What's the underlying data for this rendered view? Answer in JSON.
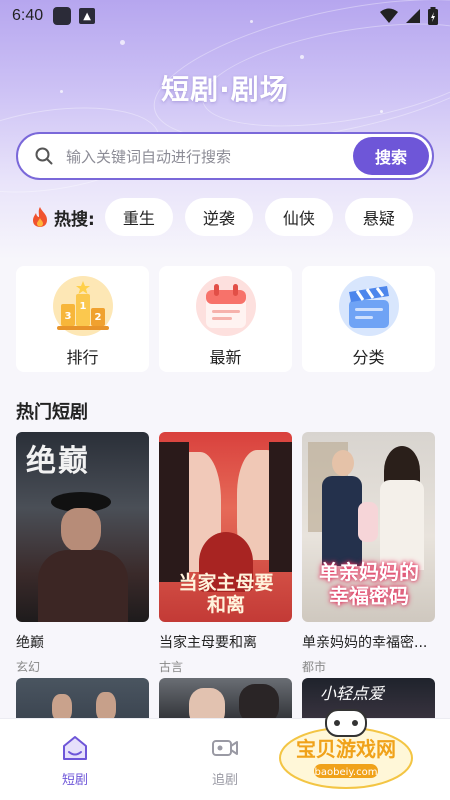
{
  "status_bar": {
    "time": "6:40"
  },
  "header": {
    "title": "短剧·剧场"
  },
  "search": {
    "placeholder": "输入关键词自动进行搜索",
    "button_label": "搜索"
  },
  "hot_search": {
    "label": "热搜:",
    "tags": [
      "重生",
      "逆袭",
      "仙侠",
      "悬疑"
    ]
  },
  "categories": [
    {
      "label": "排行",
      "icon": "podium-icon"
    },
    {
      "label": "最新",
      "icon": "calendar-icon"
    },
    {
      "label": "分类",
      "icon": "clapperboard-icon"
    }
  ],
  "section": {
    "title": "热门短剧"
  },
  "dramas": [
    {
      "title": "绝巅",
      "tag": "玄幻",
      "poster_text": "绝巅"
    },
    {
      "title": "当家主母要和离",
      "tag": "古言",
      "poster_text": "当家主母要和离"
    },
    {
      "title": "单亲妈妈的幸福密...",
      "tag": "都市",
      "poster_text": "单亲妈妈的幸福密码"
    }
  ],
  "second_row": {
    "poster_text": "小轻点爱"
  },
  "tabbar": {
    "items": [
      {
        "label": "短剧",
        "active": true,
        "icon": "home-icon"
      },
      {
        "label": "追剧",
        "active": false,
        "icon": "video-camera-icon"
      }
    ]
  },
  "watermark": {
    "text": "宝贝游戏网",
    "url": "baobeiy.com"
  },
  "colors": {
    "accent": "#6e56d8",
    "active_tab": "#6e56d8",
    "inactive_tab": "#9a9aa4"
  }
}
